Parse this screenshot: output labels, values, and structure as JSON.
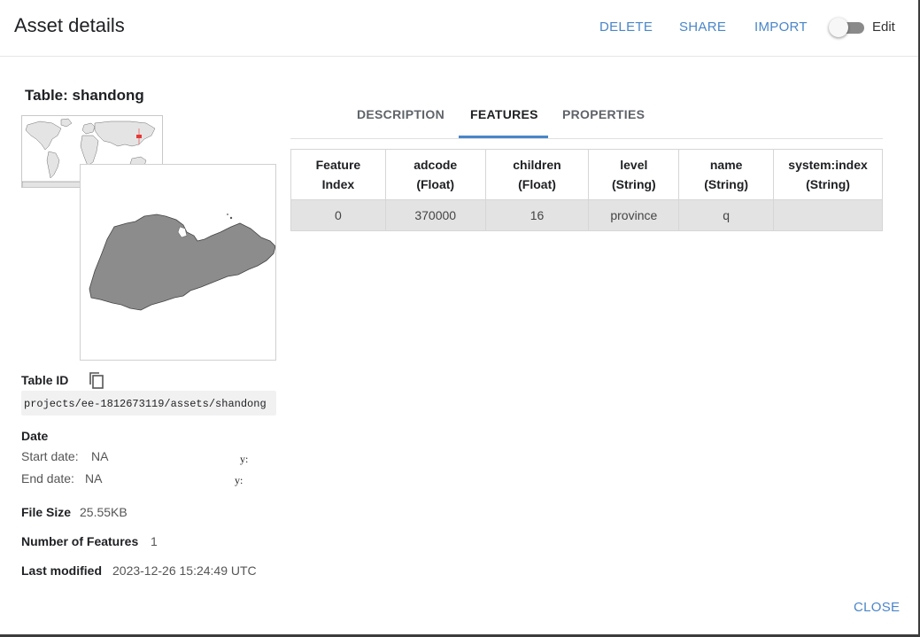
{
  "header": {
    "title": "Asset details",
    "delete_label": "DELETE",
    "share_label": "SHARE",
    "import_label": "IMPORT",
    "edit_label": "Edit",
    "edit_toggle_on": false
  },
  "asset": {
    "title": "Table: shandong",
    "table_id_label": "Table ID",
    "table_id": "projects/ee-1812673119/assets/shandong",
    "date_label": "Date",
    "start_date_label": "Start date:",
    "start_date": "NA",
    "end_date_label": "End date:",
    "end_date": "NA",
    "start_stray": "y:",
    "end_stray": "y:",
    "file_size_label": "File Size",
    "file_size": "25.55KB",
    "num_features_label": "Number of Features",
    "num_features": "1",
    "last_modified_label": "Last modified",
    "last_modified": "2023-12-26 15:24:49 UTC"
  },
  "tabs": {
    "description": "DESCRIPTION",
    "features": "FEATURES",
    "properties": "PROPERTIES",
    "active": "FEATURES"
  },
  "features_table": {
    "headers": [
      {
        "name": "Feature",
        "type": "Index"
      },
      {
        "name": "adcode",
        "type": "(Float)"
      },
      {
        "name": "children",
        "type": "(Float)"
      },
      {
        "name": "level",
        "type": "(String)"
      },
      {
        "name": "name",
        "type": "(String)"
      },
      {
        "name": "system:index",
        "type": "(String)"
      }
    ],
    "rows": [
      [
        "0",
        "370000",
        "16",
        "province",
        "q",
        ""
      ]
    ]
  },
  "footer": {
    "close_label": "CLOSE"
  },
  "colors": {
    "accent": "#4a86c8",
    "map_fill": "#8c8c8c",
    "highlight": "#e53935"
  },
  "icons": {
    "copy": "copy-icon"
  }
}
